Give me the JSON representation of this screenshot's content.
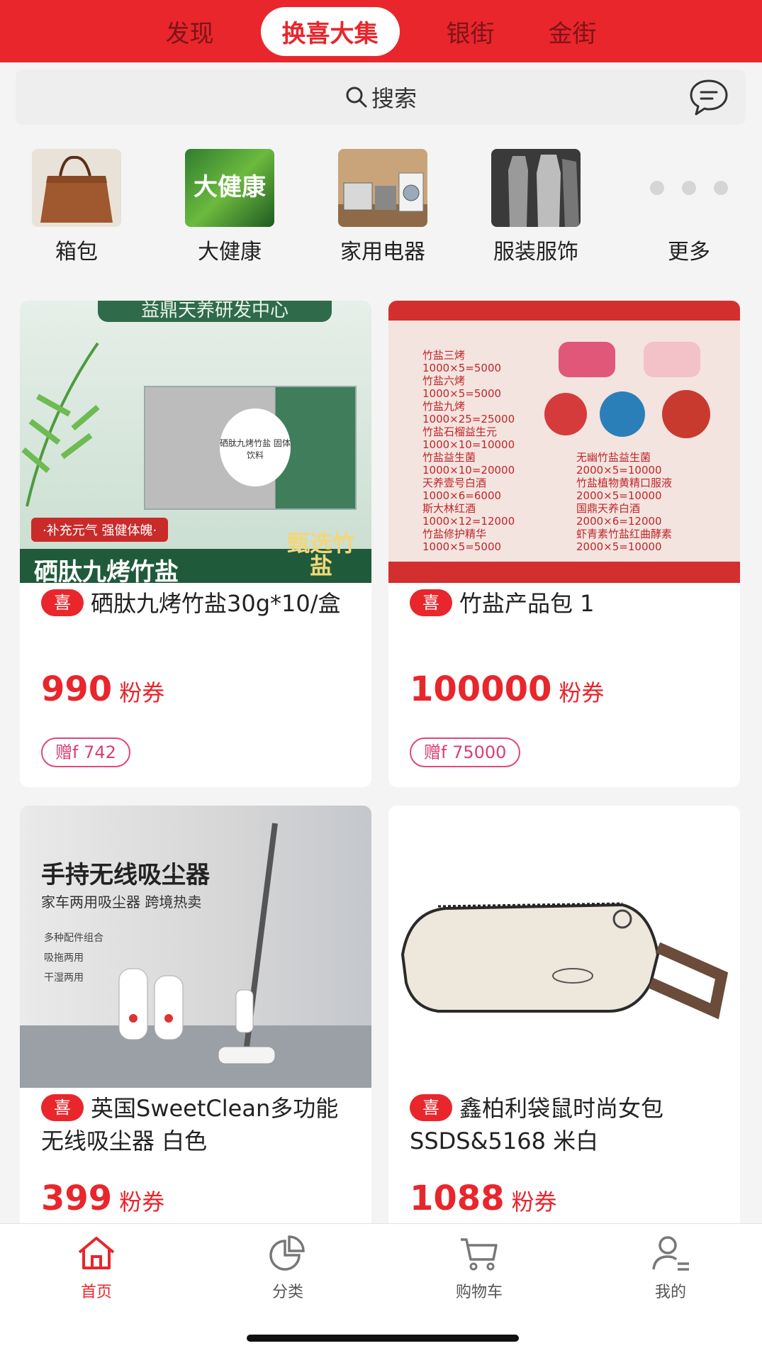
{
  "top_tabs": [
    "发现",
    "换喜大集",
    "银街",
    "金街"
  ],
  "search": {
    "placeholder": "搜索",
    "icon": "search-icon",
    "message_icon": "chat-bubble-icon"
  },
  "categories": [
    {
      "label": "箱包"
    },
    {
      "label": "大健康",
      "thumb_text": "大健康"
    },
    {
      "label": "家用电器"
    },
    {
      "label": "服装服饰"
    },
    {
      "label": "更多"
    }
  ],
  "products": [
    {
      "badge": "喜",
      "name": "硒肽九烤竹盐30g*10/盒",
      "price": "990",
      "unit": "粉券",
      "gift": "赠f 742",
      "image_text": {
        "header": "益鼎天养研发中心",
        "box": "硒肽九烤竹盐 固体饮料",
        "slogan": "·补充元气 强健体魄·",
        "title": "硒肽九烤竹盐",
        "corner": "甄选竹盐"
      }
    },
    {
      "badge": "喜",
      "name": "竹盐产品包 1",
      "price": "100000",
      "unit": "粉券",
      "gift": "赠f 75000",
      "image_text": {
        "left_lines": [
          "竹盐三烤",
          "1000×5=5000",
          "竹盐六烤",
          "1000×5=5000",
          "竹盐九烤",
          "1000×25=25000",
          "竹盐石榴益生元",
          "1000×10=10000",
          "竹盐益生菌",
          "1000×10=20000",
          "天养壹号白酒",
          "1000×6=6000",
          "斯大林红酒",
          "1000×12=12000",
          "竹盐修护精华",
          "1000×5=5000"
        ],
        "right_lines": [
          "无幽竹盐益生菌",
          "2000×5=10000",
          "竹盐植物黄精口服液",
          "2000×5=10000",
          "国鼎天养白酒",
          "2000×6=12000",
          "虾青素竹盐红曲酵素",
          "2000×5=10000"
        ]
      }
    },
    {
      "badge": "喜",
      "name": "英国SweetClean多功能无线吸尘器 白色",
      "price": "399",
      "unit": "粉券",
      "image_text": {
        "title": "手持无线吸尘器",
        "subtitle": "家车两用吸尘器 跨境热卖",
        "features": [
          "多种配件组合",
          "吸拖两用",
          "干湿两用"
        ]
      }
    },
    {
      "badge": "喜",
      "name": "鑫柏利袋鼠时尚女包SSDS&5168 米白",
      "price": "1088",
      "unit": "粉券"
    }
  ],
  "bottom_nav": [
    {
      "label": "首页",
      "icon": "home-icon",
      "active": true
    },
    {
      "label": "分类",
      "icon": "pie-chart-icon",
      "active": false
    },
    {
      "label": "购物车",
      "icon": "cart-icon",
      "active": false
    },
    {
      "label": "我的",
      "icon": "user-icon",
      "active": false
    }
  ],
  "colors": {
    "accent": "#e8262c",
    "gift": "#d94072"
  }
}
